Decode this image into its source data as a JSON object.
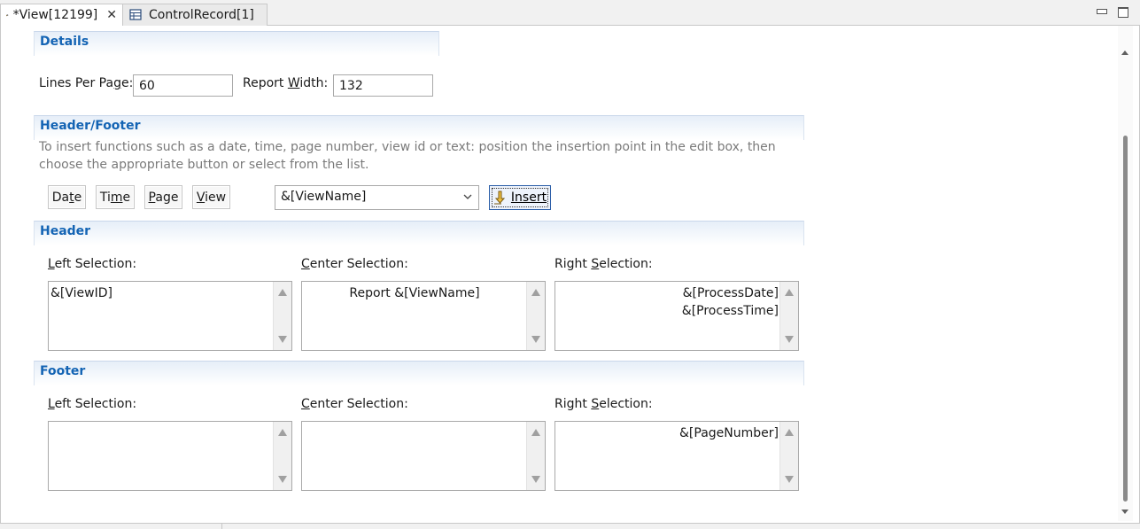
{
  "tabs": [
    {
      "label": "*View[12199]",
      "icon": "eye-icon",
      "active": true,
      "close": "✕"
    },
    {
      "label": "ControlRecord[1]",
      "icon": "table-icon",
      "active": false
    }
  ],
  "details": {
    "title": "Details",
    "lines_per_page_label": "Lines Per Page:",
    "lines_per_page_value": "60",
    "report_width_label": "Report Width:",
    "report_width_value": "132"
  },
  "header_footer": {
    "title": "Header/Footer",
    "description": "To insert functions such as a date, time, page number, view id or text: position the insertion point in the edit box, then choose the appropriate button or select from the list.",
    "buttons": [
      "Date",
      "Time",
      "Page",
      "View"
    ],
    "function_select_value": "&[ViewName]",
    "insert_label": "Insert"
  },
  "header": {
    "title": "Header",
    "left_label": "Left Selection:",
    "left_value": "&[ViewID]",
    "center_label": "Center Selection:",
    "center_value": "Report &[ViewName]",
    "right_label": "Right Selection:",
    "right_value": "&[ProcessDate]\n&[ProcessTime]"
  },
  "footer": {
    "title": "Footer",
    "left_label": "Left Selection:",
    "left_value": "",
    "center_label": "Center Selection:",
    "center_value": "",
    "right_label": "Right Selection:",
    "right_value": "&[PageNumber]"
  },
  "colors": {
    "section_title": "#1464b4",
    "description_text": "#7a7a7a",
    "insert_border": "#2b5ea8"
  }
}
